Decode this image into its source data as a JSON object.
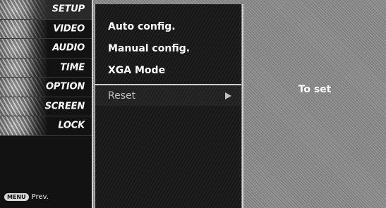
{
  "menu": {
    "items": [
      {
        "label": "SETUP",
        "active": true
      },
      {
        "label": "VIDEO"
      },
      {
        "label": "AUDIO"
      },
      {
        "label": "TIME"
      },
      {
        "label": "OPTION"
      },
      {
        "label": "SCREEN"
      },
      {
        "label": "LOCK"
      }
    ],
    "menu_key_label": "MENU",
    "prev_label": "Prev."
  },
  "submenu": {
    "items": [
      {
        "label": "Auto config."
      },
      {
        "label": "Manual config."
      },
      {
        "label": "XGA Mode"
      },
      {
        "label": "Reset"
      }
    ]
  },
  "info": {
    "text": "To set"
  }
}
